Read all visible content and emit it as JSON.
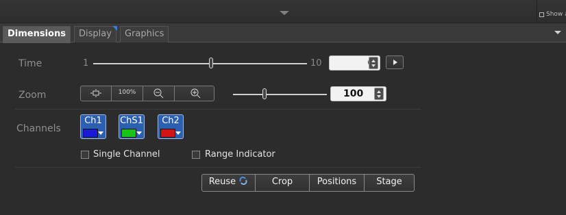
{
  "header": {
    "show_all_label": "Show all"
  },
  "tabs": [
    {
      "label": "Dimensions",
      "active": true
    },
    {
      "label": "Display",
      "active": false
    },
    {
      "label": "Graphics",
      "active": false
    }
  ],
  "time": {
    "label": "Time",
    "min": "1",
    "max": "10",
    "value": "6",
    "play_icon": "play-icon"
  },
  "zoom": {
    "label": "Zoom",
    "tool_buttons": [
      {
        "icon": "fit-to-window-icon",
        "text": ""
      },
      {
        "icon": "",
        "text": "100%"
      },
      {
        "icon": "zoom-out-icon",
        "text": ""
      },
      {
        "icon": "zoom-in-icon",
        "text": ""
      }
    ],
    "value": "100"
  },
  "channels": {
    "label": "Channels",
    "items": [
      {
        "name": "Ch1",
        "color": "#1a1ad6"
      },
      {
        "name": "ChS1",
        "color": "#19c419"
      },
      {
        "name": "Ch2",
        "color": "#d41414"
      }
    ],
    "single_channel_label": "Single Channel",
    "range_indicator_label": "Range Indicator"
  },
  "actions": {
    "reuse_label": "Reuse",
    "reuse_icon": "recycle-icon",
    "crop_label": "Crop",
    "positions_label": "Positions",
    "stage_label": "Stage"
  },
  "colors": {
    "accent_blue": "#2d5fb0",
    "tab_marker": "#3b7bd1",
    "background": "#2c2c2c"
  }
}
